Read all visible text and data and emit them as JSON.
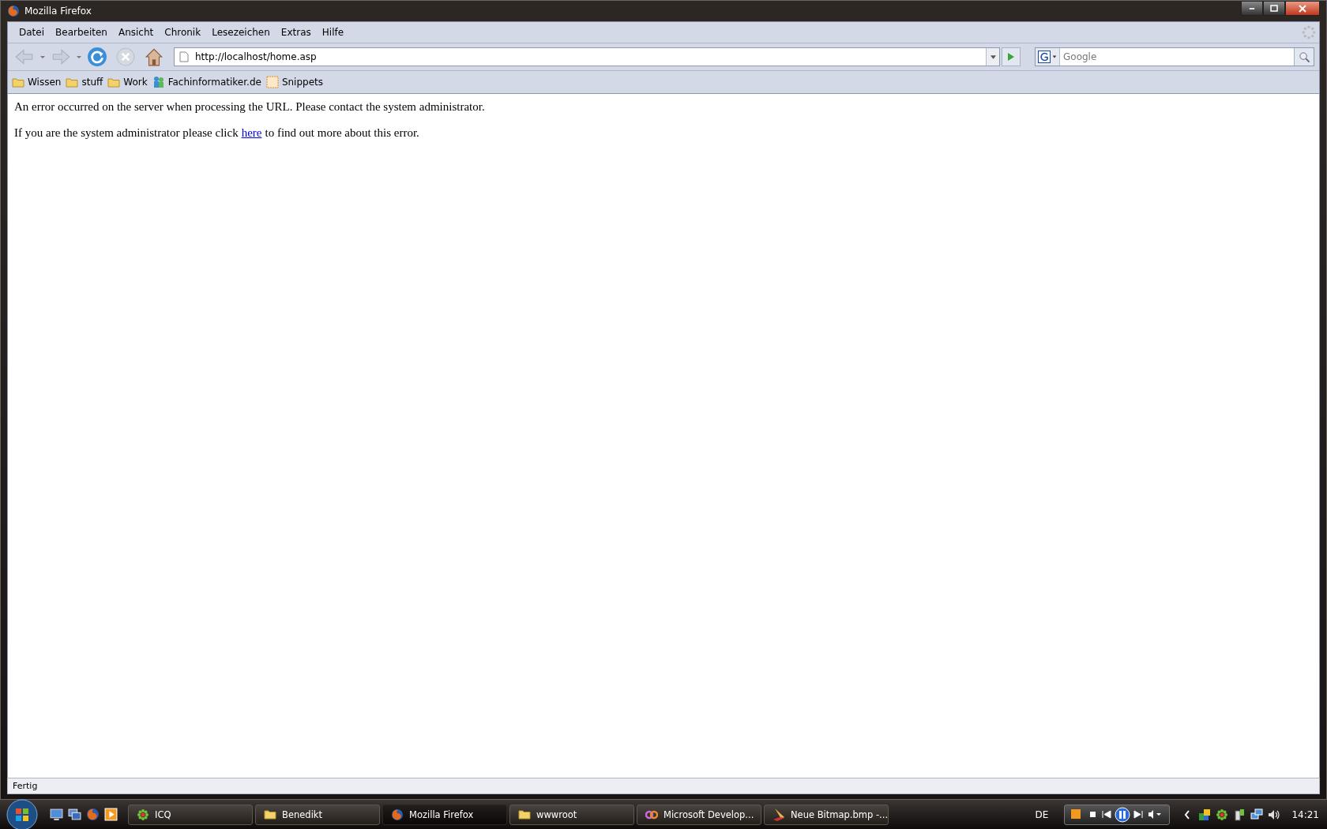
{
  "window": {
    "title": "Mozilla Firefox"
  },
  "menu": [
    "Datei",
    "Bearbeiten",
    "Ansicht",
    "Chronik",
    "Lesezeichen",
    "Extras",
    "Hilfe"
  ],
  "address": {
    "value": "http://localhost/home.asp"
  },
  "search": {
    "placeholder": "Google"
  },
  "bookmarks": [
    {
      "label": "Wissen",
      "kind": "folder"
    },
    {
      "label": "stuff",
      "kind": "folder"
    },
    {
      "label": "Work",
      "kind": "folder"
    },
    {
      "label": "Fachinformatiker.de",
      "kind": "site"
    },
    {
      "label": "Snippets",
      "kind": "feed"
    }
  ],
  "content": {
    "error": "An error occurred on the server when processing the URL. Please contact the system administrator.",
    "before_link": "If you are the system administrator please click",
    "link": "here",
    "after_link": "to find out more about this error."
  },
  "status_bar": {
    "text": "Fertig"
  },
  "taskbar": {
    "tasks": [
      {
        "label": "ICQ",
        "kind": "icq",
        "selected": false
      },
      {
        "label": "Benedikt",
        "kind": "folder",
        "selected": false
      },
      {
        "label": "Mozilla Firefox",
        "kind": "firefox",
        "selected": true
      },
      {
        "label": "wwwroot",
        "kind": "folder",
        "selected": false
      },
      {
        "label": "Microsoft Develop...",
        "kind": "devenv",
        "selected": false
      },
      {
        "label": "Neue Bitmap.bmp -...",
        "kind": "paint",
        "selected": false
      }
    ],
    "language": "DE",
    "clock": "14:21"
  }
}
